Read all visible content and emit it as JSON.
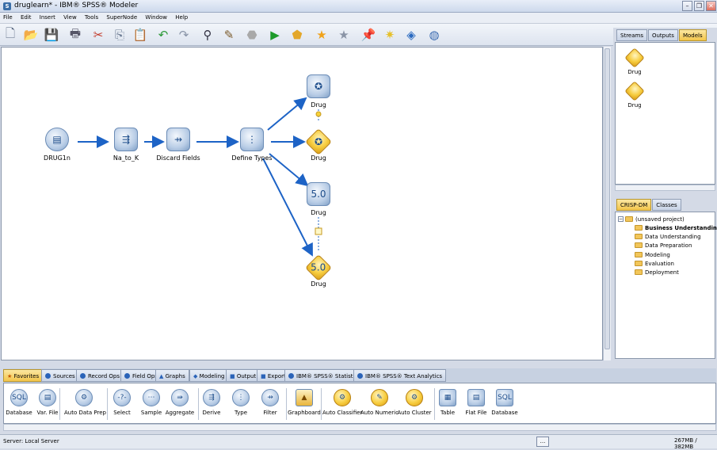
{
  "window": {
    "title": "druglearn* - IBM® SPSS® Modeler",
    "app_icon": "S"
  },
  "menu": [
    "File",
    "Edit",
    "Insert",
    "View",
    "Tools",
    "SuperNode",
    "Window",
    "Help"
  ],
  "toolbar": [
    "new-icon",
    "open-icon",
    "save-icon",
    "print-icon",
    "cut-icon",
    "copy-icon",
    "paste-icon",
    "undo-icon",
    "redo-icon",
    "find-icon",
    "annotate-icon",
    "stop-icon",
    "run-icon",
    "supernode-icon",
    "star-icon",
    "star-gray-icon",
    "pin-icon",
    "note-icon",
    "gem-icon",
    "globe-icon"
  ],
  "stream": {
    "nodes": [
      {
        "id": "drug1n",
        "label": "DRUG1n",
        "icon": "file-icon"
      },
      {
        "id": "na_to_k",
        "label": "Na_to_K",
        "icon": "derive-icon"
      },
      {
        "id": "discard",
        "label": "Discard Fields",
        "icon": "filter-icon"
      },
      {
        "id": "types",
        "label": "Define Types",
        "icon": "type-icon"
      },
      {
        "id": "nn_model",
        "label": "Drug",
        "icon": "neural-net-icon"
      },
      {
        "id": "nn_nugget",
        "label": "Drug",
        "icon": "model-nugget-icon"
      },
      {
        "id": "c50_model",
        "label": "Drug",
        "icon": "c50-icon"
      },
      {
        "id": "c50_nugget",
        "label": "Drug",
        "icon": "model-nugget-icon"
      }
    ]
  },
  "right_panel": {
    "tabs": [
      "Streams",
      "Outputs",
      "Models"
    ],
    "active_tab": "Models",
    "models": [
      {
        "label": "Drug"
      },
      {
        "label": "Drug"
      }
    ],
    "crisp_tabs": [
      "CRISP-DM",
      "Classes"
    ],
    "project": {
      "root": "(unsaved project)",
      "folders": [
        "Business Understanding",
        "Data Understanding",
        "Data Preparation",
        "Modeling",
        "Evaluation",
        "Deployment"
      ]
    }
  },
  "palette": {
    "tabs": [
      "Favorites",
      "Sources",
      "Record Ops",
      "Field Ops",
      "Graphs",
      "Modeling",
      "Output",
      "Export",
      "IBM® SPSS® Statistics",
      "IBM® SPSS® Text Analytics"
    ],
    "active_tab": "Favorites",
    "items": [
      "Database",
      "Var. File",
      "Auto Data Prep",
      "Select",
      "Sample",
      "Aggregate",
      "Derive",
      "Type",
      "Filter",
      "Graphboard",
      "Auto Classifier",
      "Auto Numeric",
      "Auto Cluster",
      "Table",
      "Flat File",
      "Database"
    ]
  },
  "status": {
    "server": "Server: Local Server",
    "memory": "267MB / 382MB",
    "dots": "..."
  }
}
